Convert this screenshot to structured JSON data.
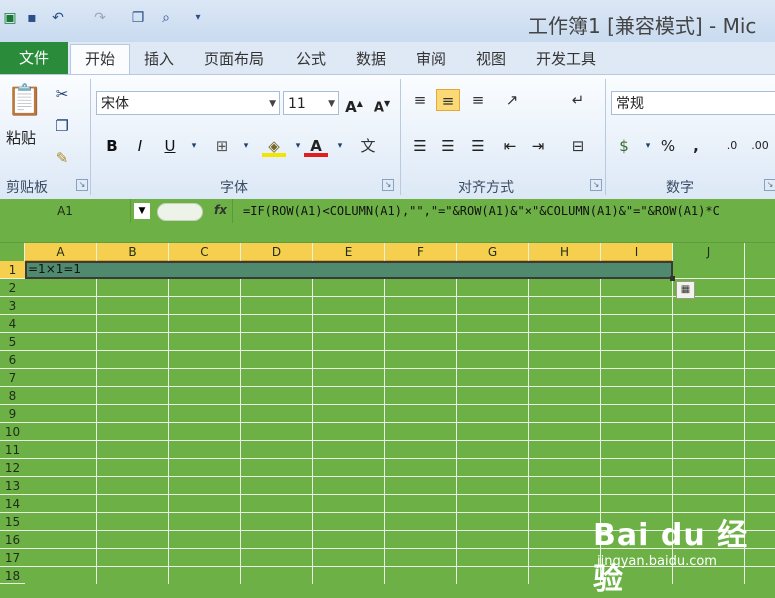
{
  "window": {
    "title": "工作簿1  [兼容模式]  -  Mic"
  },
  "tabs": [
    "文件",
    "开始",
    "插入",
    "页面布局",
    "公式",
    "数据",
    "审阅",
    "视图",
    "开发工具"
  ],
  "ribbon": {
    "clipboard": {
      "label": "剪贴板",
      "paste": "粘贴"
    },
    "font": {
      "label": "字体",
      "name": "宋体",
      "size": "11"
    },
    "alignment": {
      "label": "对齐方式"
    },
    "number": {
      "label": "数字",
      "format": "常规"
    }
  },
  "formula_bar": {
    "name_box": "A1",
    "fx": "fx",
    "formula": "=IF(ROW(A1)<COLUMN(A1),\"\",\"=\"&ROW(A1)&\"×\"&COLUMN(A1)&\"=\"&ROW(A1)*C"
  },
  "sheet": {
    "columns": [
      "A",
      "B",
      "C",
      "D",
      "E",
      "F",
      "G",
      "H",
      "I",
      "J"
    ],
    "rows": [
      "1",
      "2",
      "3",
      "4",
      "5",
      "6",
      "7",
      "8",
      "9",
      "10",
      "11",
      "12",
      "13",
      "14",
      "15",
      "16",
      "17",
      "18"
    ],
    "cell_A1": "=1×1=1"
  },
  "watermark": {
    "logo": "Bai du 经验",
    "url": "jingyan.baidu.com"
  },
  "colors": {
    "sheet_bg": "#6db146",
    "selection": "#4f8a6e",
    "header_selected": "#f7cf4e"
  }
}
